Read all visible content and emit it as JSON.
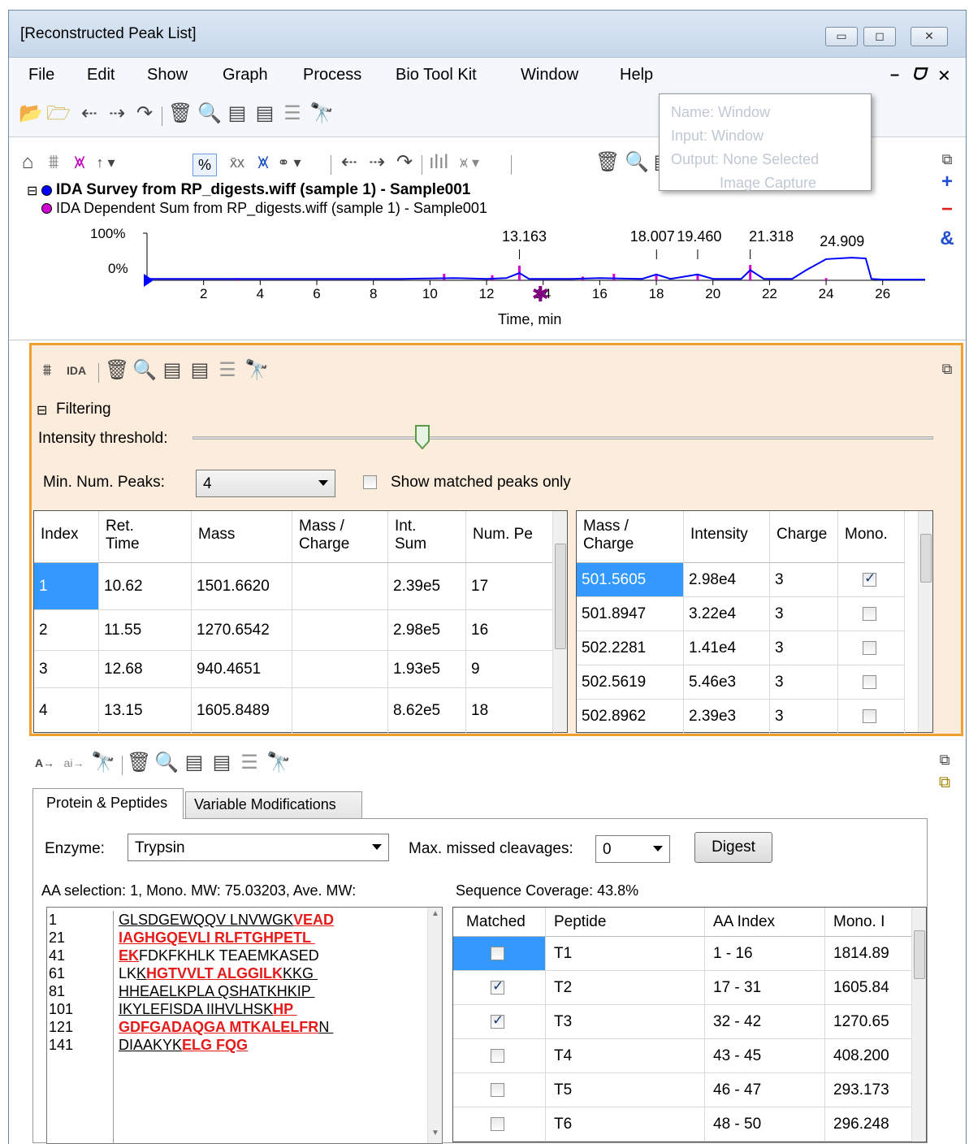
{
  "window": {
    "title": "[Reconstructed Peak List]",
    "min": "▭",
    "max": "◻",
    "close": "✕"
  },
  "menu": [
    "File",
    "Edit",
    "Show",
    "Graph",
    "Process",
    "Bio Tool Kit",
    "Window",
    "Help"
  ],
  "menu_right": {
    "min": "–",
    "restore": "🗗",
    "close": "✕"
  },
  "tooltip": {
    "l1": "Name: Window",
    "l2": "Input: Window",
    "l3": "Output: None Selected",
    "l4": "Image Capture"
  },
  "chart": {
    "title1": "IDA Survey from RP_digests.wiff (sample 1) - Sample001",
    "title2": "IDA Dependent Sum from RP_digests.wiff (sample 1) - Sample001",
    "y_top": "100%",
    "y_bot": "0%",
    "xlabel": "Time, min",
    "peaks": [
      "13.163",
      "18.007",
      "19.460",
      "21.318",
      "24.909"
    ],
    "ticks": [
      "2",
      "4",
      "6",
      "8",
      "10",
      "12",
      "14",
      "16",
      "18",
      "20",
      "22",
      "24",
      "26"
    ],
    "pct_btn": "%",
    "series_colors": {
      "survey": "#0000ff",
      "dependent": "#d000d0"
    }
  },
  "chart_data": {
    "type": "line",
    "xlabel": "Time, min",
    "ylim": [
      0,
      100
    ],
    "xlim": [
      0,
      27.5
    ],
    "series": [
      {
        "name": "IDA Survey from RP_digests.wiff (sample 1) - Sample001",
        "x": [
          0,
          3,
          6,
          9,
          10.9,
          12,
          12.7,
          13.16,
          13.5,
          15,
          16,
          17.5,
          18.0,
          18.5,
          19.46,
          20,
          21.0,
          21.32,
          21.8,
          22.8,
          23.3,
          24.0,
          24.9,
          25.4,
          25.6,
          26,
          27.5
        ],
        "y": [
          2,
          2,
          2,
          2,
          3,
          2,
          3,
          10,
          2,
          2,
          3,
          2,
          8,
          2,
          8,
          2,
          2,
          14,
          2,
          2,
          14,
          29,
          31,
          30,
          2,
          1,
          1
        ]
      },
      {
        "name": "IDA Dependent Sum from RP_digests.wiff (sample 1) - Sample001",
        "x": [
          3.2,
          10.5,
          12.2,
          13.16,
          15.4,
          16.5,
          18.0,
          19.46,
          21.32,
          24.0
        ],
        "y": [
          3,
          9,
          7,
          20,
          5,
          9,
          9,
          7,
          21,
          3
        ]
      }
    ],
    "annotations": [
      "13.163",
      "18.007",
      "19.460",
      "21.318",
      "24.909"
    ]
  },
  "filter": {
    "title": "Filtering",
    "threshold_label": "Intensity threshold:",
    "threshold_value": 0.31,
    "minpeaks_label": "Min. Num. Peaks:",
    "minpeaks_value": "4",
    "show_matched": "Show matched peaks only"
  },
  "peaks_table": {
    "headers": [
      "Index",
      "Ret.\nTime",
      "Mass",
      "Mass /\nCharge",
      "Int.\nSum",
      "Num. Pe"
    ],
    "rows": [
      [
        "1",
        "10.62",
        "1501.6620",
        "",
        "2.39e5",
        "17"
      ],
      [
        "2",
        "11.55",
        "1270.6542",
        "",
        "2.98e5",
        "16"
      ],
      [
        "3",
        "12.68",
        "940.4651",
        "",
        "1.93e5",
        "9"
      ],
      [
        "4",
        "13.15",
        "1605.8489",
        "",
        "8.62e5",
        "18"
      ]
    ]
  },
  "mz_table": {
    "headers": [
      "Mass /\nCharge",
      "Intensity",
      "Charge",
      "Mono."
    ],
    "rows": [
      [
        "501.5605",
        "2.98e4",
        "3",
        true
      ],
      [
        "501.8947",
        "3.22e4",
        "3",
        false
      ],
      [
        "502.2281",
        "1.41e4",
        "3",
        false
      ],
      [
        "502.5619",
        "5.46e3",
        "3",
        false
      ],
      [
        "502.8962",
        "2.39e3",
        "3",
        false
      ]
    ]
  },
  "tabs": [
    "Protein & Peptides",
    "Variable Modifications"
  ],
  "digest": {
    "enzyme_label": "Enzyme:",
    "enzyme": "Trypsin",
    "missed_label": "Max. missed cleavages:",
    "missed": "0",
    "digest_btn": "Digest",
    "aa_sel": "AA selection: 1, Mono. MW: 75.03203, Ave. MW:",
    "coverage": "Sequence Coverage: 43.8%"
  },
  "sequence": {
    "index": [
      "1",
      "21",
      "41",
      "61",
      "81",
      "101",
      "121",
      "141"
    ],
    "lines": [
      [
        [
          "GLSDGEWQQV LNVWGK",
          "u"
        ],
        [
          "VEAD",
          "r"
        ]
      ],
      [
        [
          "IAGHGQEVLI RLFTGHPETL ",
          "r"
        ]
      ],
      [
        [
          "EK",
          "r"
        ],
        [
          "FDKFKHLK TEAEMKASED",
          "n"
        ]
      ],
      [
        [
          "LK",
          "n"
        ],
        [
          "K",
          "u"
        ],
        [
          "HGTVVLT ALGGILK",
          "r"
        ],
        [
          "KKG ",
          "u"
        ]
      ],
      [
        [
          "HHEAELKPLA QSHATKHKIP ",
          "u"
        ]
      ],
      [
        [
          "IKYLEFISDA IIHVLHSK",
          "u"
        ],
        [
          "HP ",
          "r"
        ]
      ],
      [
        [
          "GDFGADAQGA MTKALELFR",
          "r"
        ],
        [
          "N ",
          "u"
        ]
      ],
      [
        [
          "DIAAKYK",
          "u"
        ],
        [
          "ELG FQG",
          "r"
        ]
      ]
    ]
  },
  "pep_table": {
    "headers": [
      "Matched",
      "Peptide",
      "AA Index",
      "Mono. I"
    ],
    "rows": [
      [
        false,
        "T1",
        "1 - 16",
        "1814.89"
      ],
      [
        true,
        "T2",
        "17 - 31",
        "1605.84"
      ],
      [
        true,
        "T3",
        "32 - 42",
        "1270.65"
      ],
      [
        false,
        "T4",
        "43 - 45",
        "408.200"
      ],
      [
        false,
        "T5",
        "46 - 47",
        "293.173"
      ],
      [
        false,
        "T6",
        "48 - 50",
        "296.248"
      ]
    ]
  }
}
